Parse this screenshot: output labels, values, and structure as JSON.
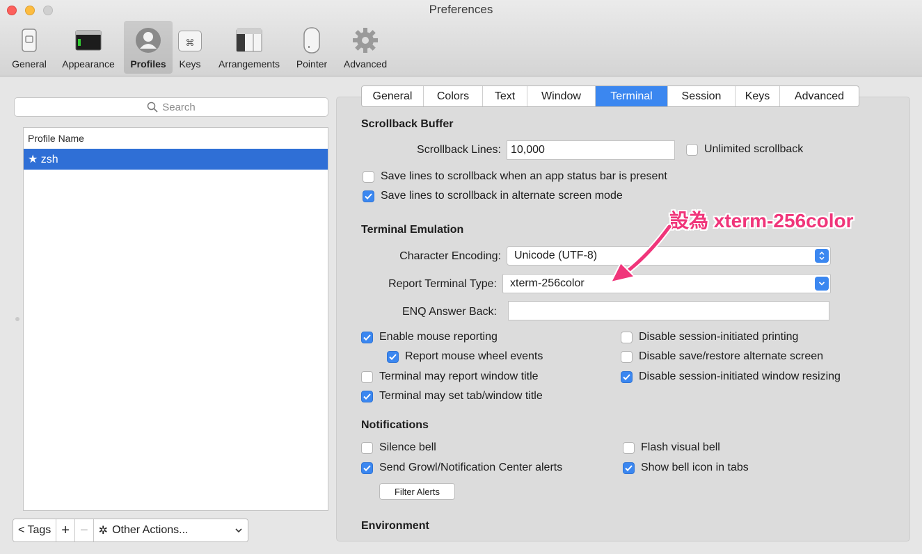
{
  "window": {
    "title": "Preferences"
  },
  "toolbar": {
    "items": [
      {
        "label": "General",
        "icon": "general-switch-icon"
      },
      {
        "label": "Appearance",
        "icon": "appearance-window-icon"
      },
      {
        "label": "Profiles",
        "icon": "profiles-person-icon",
        "selected": true
      },
      {
        "label": "Keys",
        "icon": "keys-command-icon"
      },
      {
        "label": "Arrangements",
        "icon": "arrangements-window-icon"
      },
      {
        "label": "Pointer",
        "icon": "pointer-mouse-icon"
      },
      {
        "label": "Advanced",
        "icon": "advanced-gear-icon"
      }
    ],
    "keys_icon_glyph": "⌘"
  },
  "sidebar": {
    "search_placeholder": "Search",
    "column_header": "Profile Name",
    "profiles": [
      {
        "name": "★ zsh",
        "selected": true
      }
    ],
    "tags_button": "< Tags",
    "add_button": "+",
    "remove_button": "−",
    "other_actions": "Other Actions...",
    "gear_glyph": "✲"
  },
  "tabs": [
    {
      "label": "General"
    },
    {
      "label": "Colors"
    },
    {
      "label": "Text"
    },
    {
      "label": "Window"
    },
    {
      "label": "Terminal",
      "active": true
    },
    {
      "label": "Session"
    },
    {
      "label": "Keys"
    },
    {
      "label": "Advanced"
    }
  ],
  "scrollback": {
    "heading": "Scrollback Buffer",
    "lines_label": "Scrollback Lines:",
    "lines_value": "10,000",
    "unlimited_label": "Unlimited scrollback",
    "unlimited_checked": false,
    "status_bar_label": "Save lines to scrollback when an app status bar is present",
    "status_bar_checked": false,
    "alternate_label": "Save lines to scrollback in alternate screen mode",
    "alternate_checked": true
  },
  "emulation": {
    "heading": "Terminal Emulation",
    "encoding_label": "Character Encoding:",
    "encoding_value": "Unicode (UTF-8)",
    "type_label": "Report Terminal Type:",
    "type_value": "xterm-256color",
    "enq_label": "ENQ Answer Back:",
    "enq_value": "",
    "checks_left": [
      {
        "label": "Enable mouse reporting",
        "checked": true
      },
      {
        "label": "Report mouse wheel events",
        "checked": true
      },
      {
        "label": "Terminal may report window title",
        "checked": false
      },
      {
        "label": "Terminal may set tab/window title",
        "checked": true
      }
    ],
    "checks_right": [
      {
        "label": "Disable session-initiated printing",
        "checked": false
      },
      {
        "label": "Disable save/restore alternate screen",
        "checked": false
      },
      {
        "label": "Disable session-initiated window resizing",
        "checked": true
      }
    ]
  },
  "notifications": {
    "heading": "Notifications",
    "silence_bell": {
      "label": "Silence bell",
      "checked": false
    },
    "flash_bell": {
      "label": "Flash visual bell",
      "checked": false
    },
    "growl": {
      "label": "Send Growl/Notification Center alerts",
      "checked": true
    },
    "bell_icon": {
      "label": "Show bell icon in tabs",
      "checked": true
    },
    "filter_button": "Filter Alerts"
  },
  "environment": {
    "heading": "Environment"
  },
  "annotation": {
    "text": "設為 xterm-256color",
    "color": "#f0357a"
  },
  "colors": {
    "accent": "#3b87f0",
    "selection": "#2f6fd6"
  }
}
